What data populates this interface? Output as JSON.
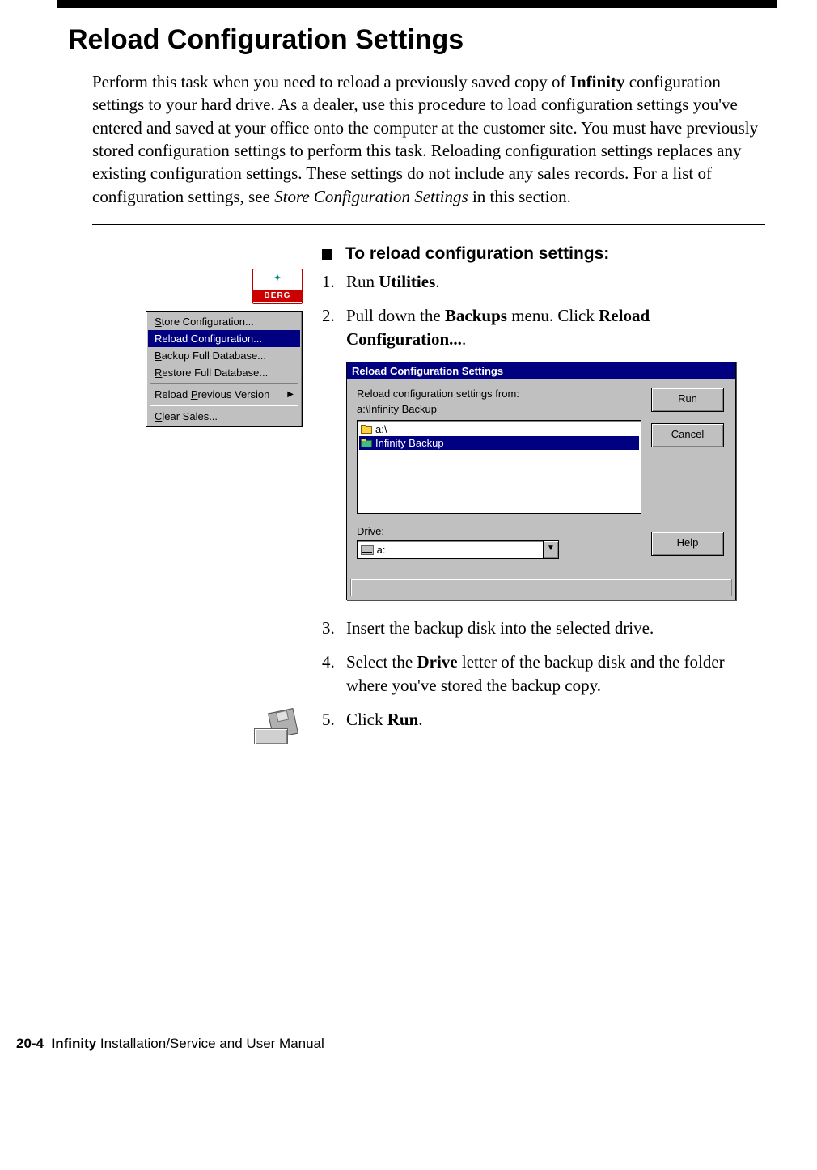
{
  "title": "Reload Configuration Settings",
  "intro": {
    "pre": "Perform this task when you need to reload a previously saved copy of ",
    "bold1": "Infinity",
    "mid": " configuration settings to your hard drive. As a dealer, use this procedure to load configuration settings you've entered and saved at your office onto the computer at the customer site. You must have previously stored configuration settings to perform this task. Reloading configuration settings replaces any existing configuration settings. These settings do not include any sales records. For a list of configuration settings, see ",
    "italic": "Store Configuration Settings",
    "post": " in this section."
  },
  "logo_text": "BERG",
  "subheading": "To reload configuration settings:",
  "steps": {
    "s1_num": "1.",
    "s1_a": "Run ",
    "s1_b": "Utilities",
    "s1_c": ".",
    "s2_num": "2.",
    "s2_a": "Pull down the ",
    "s2_b": "Backups",
    "s2_c": " menu. Click ",
    "s2_d": "Reload Configuration...",
    "s2_e": ".",
    "s3_num": "3.",
    "s3_a": "Insert the backup disk into the selected drive.",
    "s4_num": "4.",
    "s4_a": "Select the ",
    "s4_b": "Drive",
    "s4_c": " letter of the backup disk and the folder where you've stored the backup copy.",
    "s5_num": "5.",
    "s5_a": "Click ",
    "s5_b": "Run",
    "s5_c": "."
  },
  "menu": {
    "store": "Store Configuration...",
    "reload": "Reload Configuration...",
    "backup": "Backup Full Database...",
    "restore": "Restore Full Database...",
    "prev": "Reload Previous Version",
    "clear": "Clear Sales..."
  },
  "dialog": {
    "title": "Reload Configuration Settings",
    "label_from": "Reload configuration settings from:",
    "path": "a:\\Infinity Backup",
    "list_root": "a:\\",
    "list_sel": "Infinity Backup",
    "drive_label": "Drive:",
    "drive_value": " a:",
    "btn_run": "Run",
    "btn_cancel": "Cancel",
    "btn_help": "Help"
  },
  "footer": {
    "page": "20-4",
    "product": "Infinity",
    "rest": " Installation/Service and User Manual"
  }
}
